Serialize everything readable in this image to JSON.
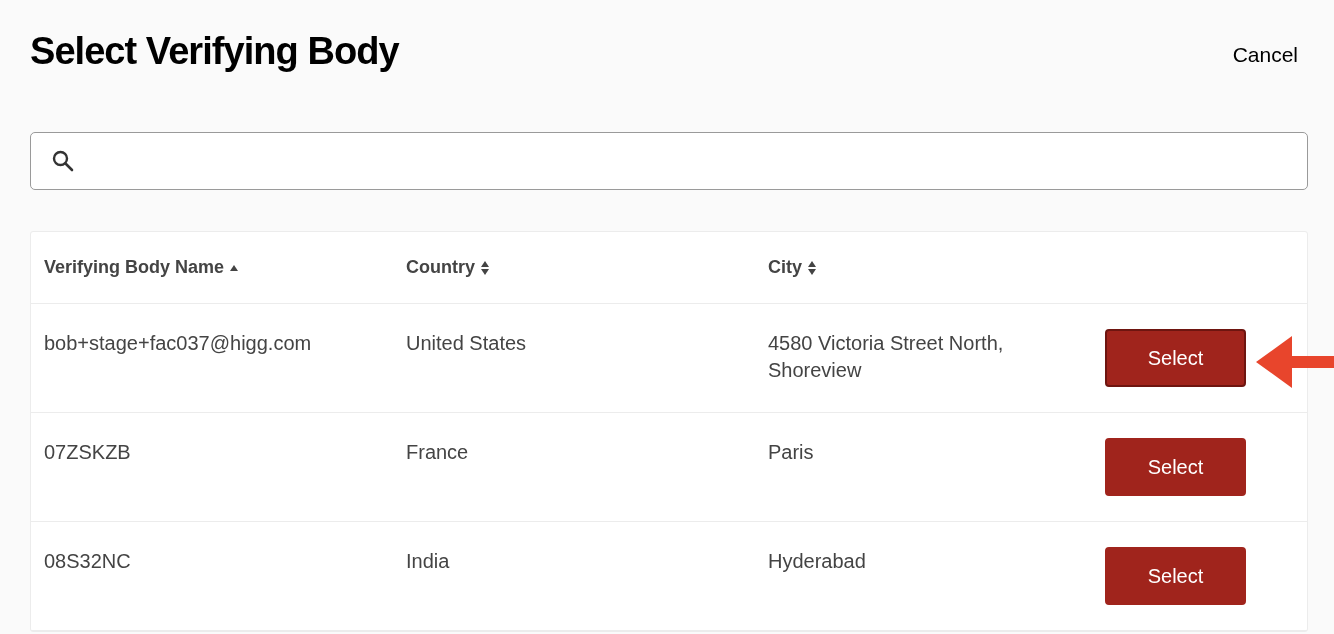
{
  "title": "Select Verifying Body",
  "cancel": "Cancel",
  "table": {
    "columns": [
      {
        "label": "Verifying Body Name",
        "sorted": true
      },
      {
        "label": "Country",
        "sorted": false
      },
      {
        "label": "City",
        "sorted": false
      }
    ],
    "rows": [
      {
        "name": "bob+stage+fac037@higg.com",
        "country": "United States",
        "city": "4580 Victoria Street North, Shoreview",
        "action": "Select",
        "focused": true
      },
      {
        "name": "07ZSKZB",
        "country": "France",
        "city": "Paris",
        "action": "Select",
        "focused": false
      },
      {
        "name": "08S32NC",
        "country": "India",
        "city": "Hyderabad",
        "action": "Select",
        "focused": false
      }
    ]
  }
}
